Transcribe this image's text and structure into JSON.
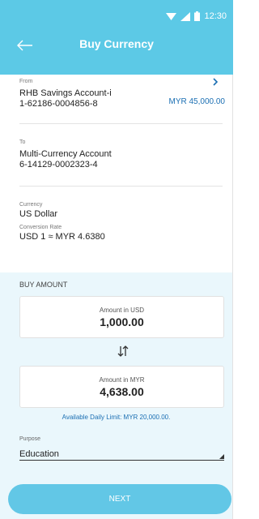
{
  "status_bar": {
    "time": "12:30"
  },
  "header": {
    "title": "Buy Currency"
  },
  "from": {
    "label": "From",
    "account_name": "RHB Savings Account-i",
    "account_number": "1-62186-0004856-8",
    "balance": "MYR 45,000.00"
  },
  "to": {
    "label": "To",
    "account_name": "Multi-Currency Account",
    "account_number": "6-14129-0002323-4"
  },
  "currency": {
    "label": "Currency",
    "value": "US Dollar",
    "rate_label": "Conversion Rate",
    "rate_value": "USD 1 ≈ MYR 4.6380"
  },
  "buy_amount": {
    "section_label": "BUY AMOUNT",
    "usd_label": "Amount in USD",
    "usd_value": "1,000.00",
    "myr_label": "Amount in MYR",
    "myr_value": "4,638.00",
    "limit_text": "Available Daily Limit: MYR 20,000.00."
  },
  "purpose": {
    "label": "Purpose",
    "value": "Education"
  },
  "next_button": {
    "label": "NEXT"
  },
  "colors": {
    "header": "#5cc9e6",
    "accent": "#1b6fb3",
    "panel": "#eaf7fc"
  }
}
